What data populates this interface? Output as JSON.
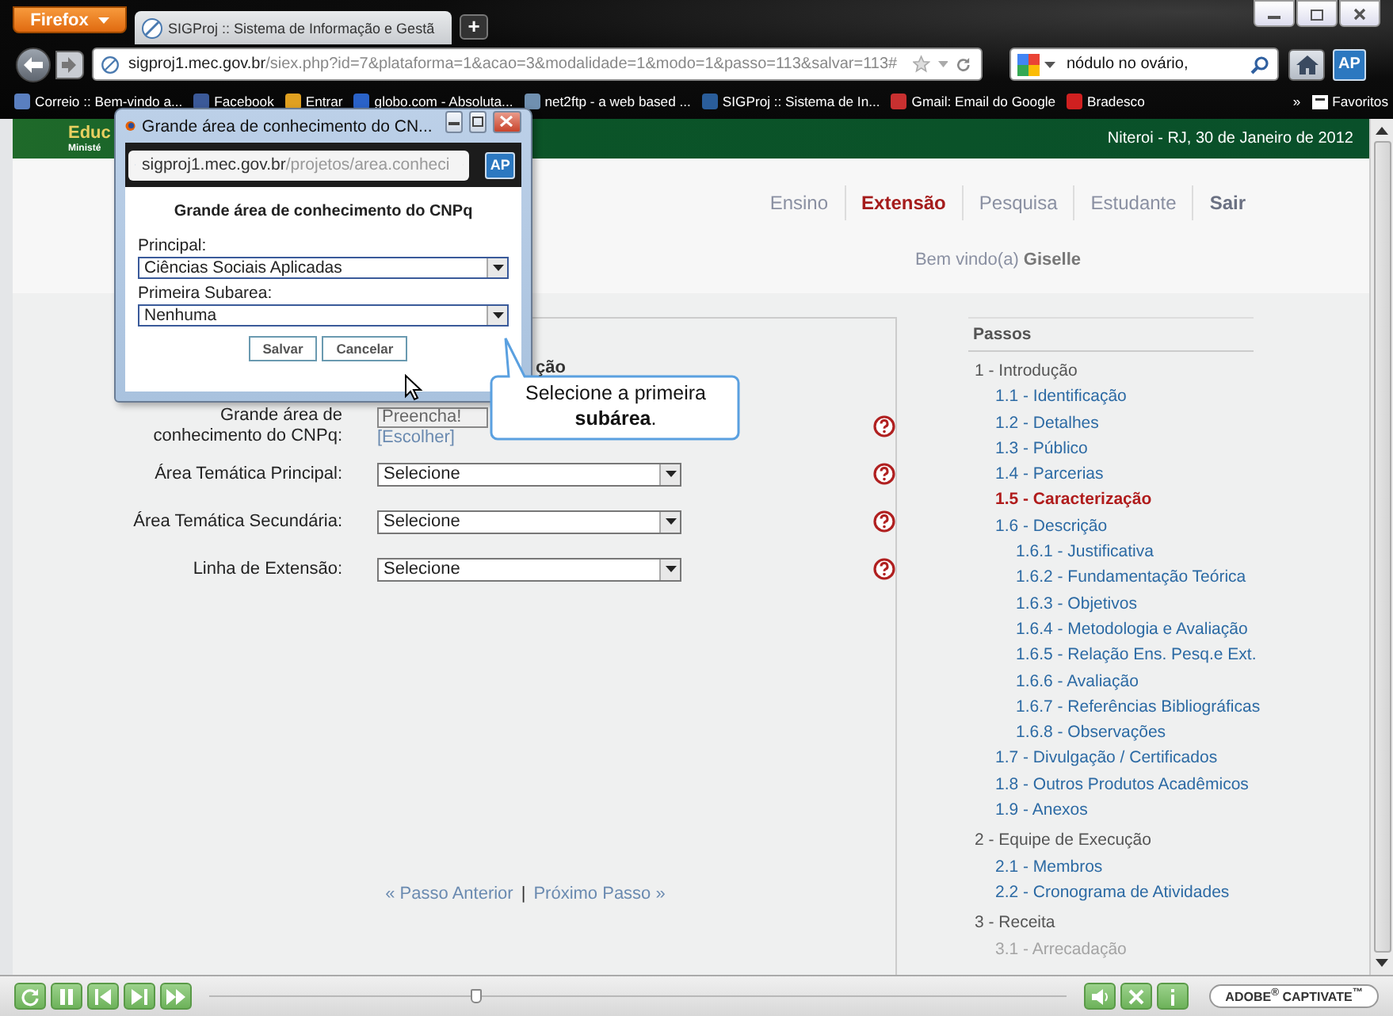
{
  "browser": {
    "app_button": "Firefox",
    "tab": {
      "title": "SIGProj :: Sistema de Informação e Gestã",
      "selected": true
    },
    "new_tab": "+",
    "url": {
      "host": "sigproj1.mec.gov.br",
      "path": "/siex.php?id=7&plataforma=1&acao=3&modalidade=1&modo=1&passo=113&salvar=113#"
    },
    "search": {
      "value": "nódulo no ovário,"
    },
    "profile_badge": "AP",
    "bookmarks": [
      "Correio :: Bem-vindo a...",
      "Facebook",
      "Entrar",
      "globo.com - Absoluta...",
      "net2ftp - a web based ...",
      "SIGProj :: Sistema de In...",
      "Gmail: Email do Google",
      "Bradesco"
    ],
    "bookmarks_overflow": "»",
    "bookmarks_folder": "Favoritos"
  },
  "site": {
    "brand": "Educ",
    "ministry": "Ministé",
    "location_date": "Niteroi - RJ, 30 de Janeiro de 2012",
    "menu": [
      {
        "label": "Ensino",
        "kind": "menu",
        "selected": false
      },
      {
        "label": "Extensão",
        "kind": "menu",
        "selected": true
      },
      {
        "label": "Pesquisa",
        "kind": "menu",
        "selected": false
      },
      {
        "label": "Estudante",
        "kind": "menu",
        "selected": false
      },
      {
        "label": "Sair",
        "kind": "exit",
        "selected": false
      }
    ],
    "welcome": {
      "text": "Bem vindo(a)",
      "user": "Giselle"
    }
  },
  "form": {
    "section_title": "ção",
    "rows": [
      {
        "kind": "choose",
        "label": "Grande área de conhecimento do CNPq:",
        "value": "Preencha!",
        "link": "[Escolher]"
      },
      {
        "kind": "select",
        "label": "Área Temática Principal:",
        "value": "Selecione"
      },
      {
        "kind": "select",
        "label": "Área Temática Secundária:",
        "value": "Selecione"
      },
      {
        "kind": "select",
        "label": "Linha de Extensão:",
        "value": "Selecione"
      }
    ],
    "pager": {
      "previous": "« Passo Anterior",
      "separator": "|",
      "next": "Próximo Passo »"
    }
  },
  "steps": {
    "title": "Passos",
    "sections": [
      {
        "label": "1 - Introdução",
        "selected": false,
        "disabled": false,
        "children": [
          {
            "label": "1.1 - Identificação",
            "selected": false,
            "disabled": false
          },
          {
            "label": "1.2 - Detalhes",
            "selected": false,
            "disabled": false
          },
          {
            "label": "1.3 - Público",
            "selected": false,
            "disabled": false
          },
          {
            "label": "1.4 - Parcerias",
            "selected": false,
            "disabled": false
          },
          {
            "label": "1.5 - Caracterização",
            "selected": true,
            "disabled": false
          },
          {
            "label": "1.6 - Descrição",
            "selected": false,
            "disabled": false,
            "children": [
              {
                "label": "1.6.1 - Justificativa",
                "selected": false,
                "disabled": false
              },
              {
                "label": "1.6.2 - Fundamentação Teórica",
                "selected": false,
                "disabled": false
              },
              {
                "label": "1.6.3 - Objetivos",
                "selected": false,
                "disabled": false
              },
              {
                "label": "1.6.4 - Metodologia e Avaliação",
                "selected": false,
                "disabled": false
              },
              {
                "label": "1.6.5 - Relação Ens. Pesq.e Ext.",
                "selected": false,
                "disabled": false
              },
              {
                "label": "1.6.6 - Avaliação",
                "selected": false,
                "disabled": false
              },
              {
                "label": "1.6.7 - Referências Bibliográficas",
                "selected": false,
                "disabled": false
              },
              {
                "label": "1.6.8 - Observações",
                "selected": false,
                "disabled": false
              }
            ]
          },
          {
            "label": "1.7 - Divulgação / Certificados",
            "selected": false,
            "disabled": false
          },
          {
            "label": "1.8 - Outros Produtos Acadêmicos",
            "selected": false,
            "disabled": false
          },
          {
            "label": "1.9 - Anexos",
            "selected": false,
            "disabled": false
          }
        ]
      },
      {
        "label": "2 - Equipe de Execução",
        "selected": false,
        "disabled": false,
        "children": [
          {
            "label": "2.1 - Membros",
            "selected": false,
            "disabled": false
          },
          {
            "label": "2.2 - Cronograma de Atividades",
            "selected": false,
            "disabled": false
          }
        ]
      },
      {
        "label": "3 - Receita",
        "selected": false,
        "disabled": false,
        "children": [
          {
            "label": "3.1 - Arrecadação",
            "selected": false,
            "disabled": true
          }
        ]
      }
    ]
  },
  "popup": {
    "title": "Grande área de conhecimento do CN...",
    "url": {
      "host": "sigproj1.mec.gov.br",
      "path": "/projetos/area.conheci"
    },
    "profile_badge": "AP",
    "heading": "Grande área de conhecimento do CNPq",
    "fields": [
      {
        "label": "Principal:",
        "value": "Ciências Sociais Aplicadas"
      },
      {
        "label": "Primeira Subarea:",
        "value": "Nenhuma"
      }
    ],
    "buttons": [
      "Salvar",
      "Cancelar"
    ]
  },
  "callout": {
    "text": "Selecione a primeira **subárea**."
  },
  "player": {
    "level": 0.31,
    "logo": "ADOBE$^{®}$ CAPTIVATE$^{™}$"
  }
}
